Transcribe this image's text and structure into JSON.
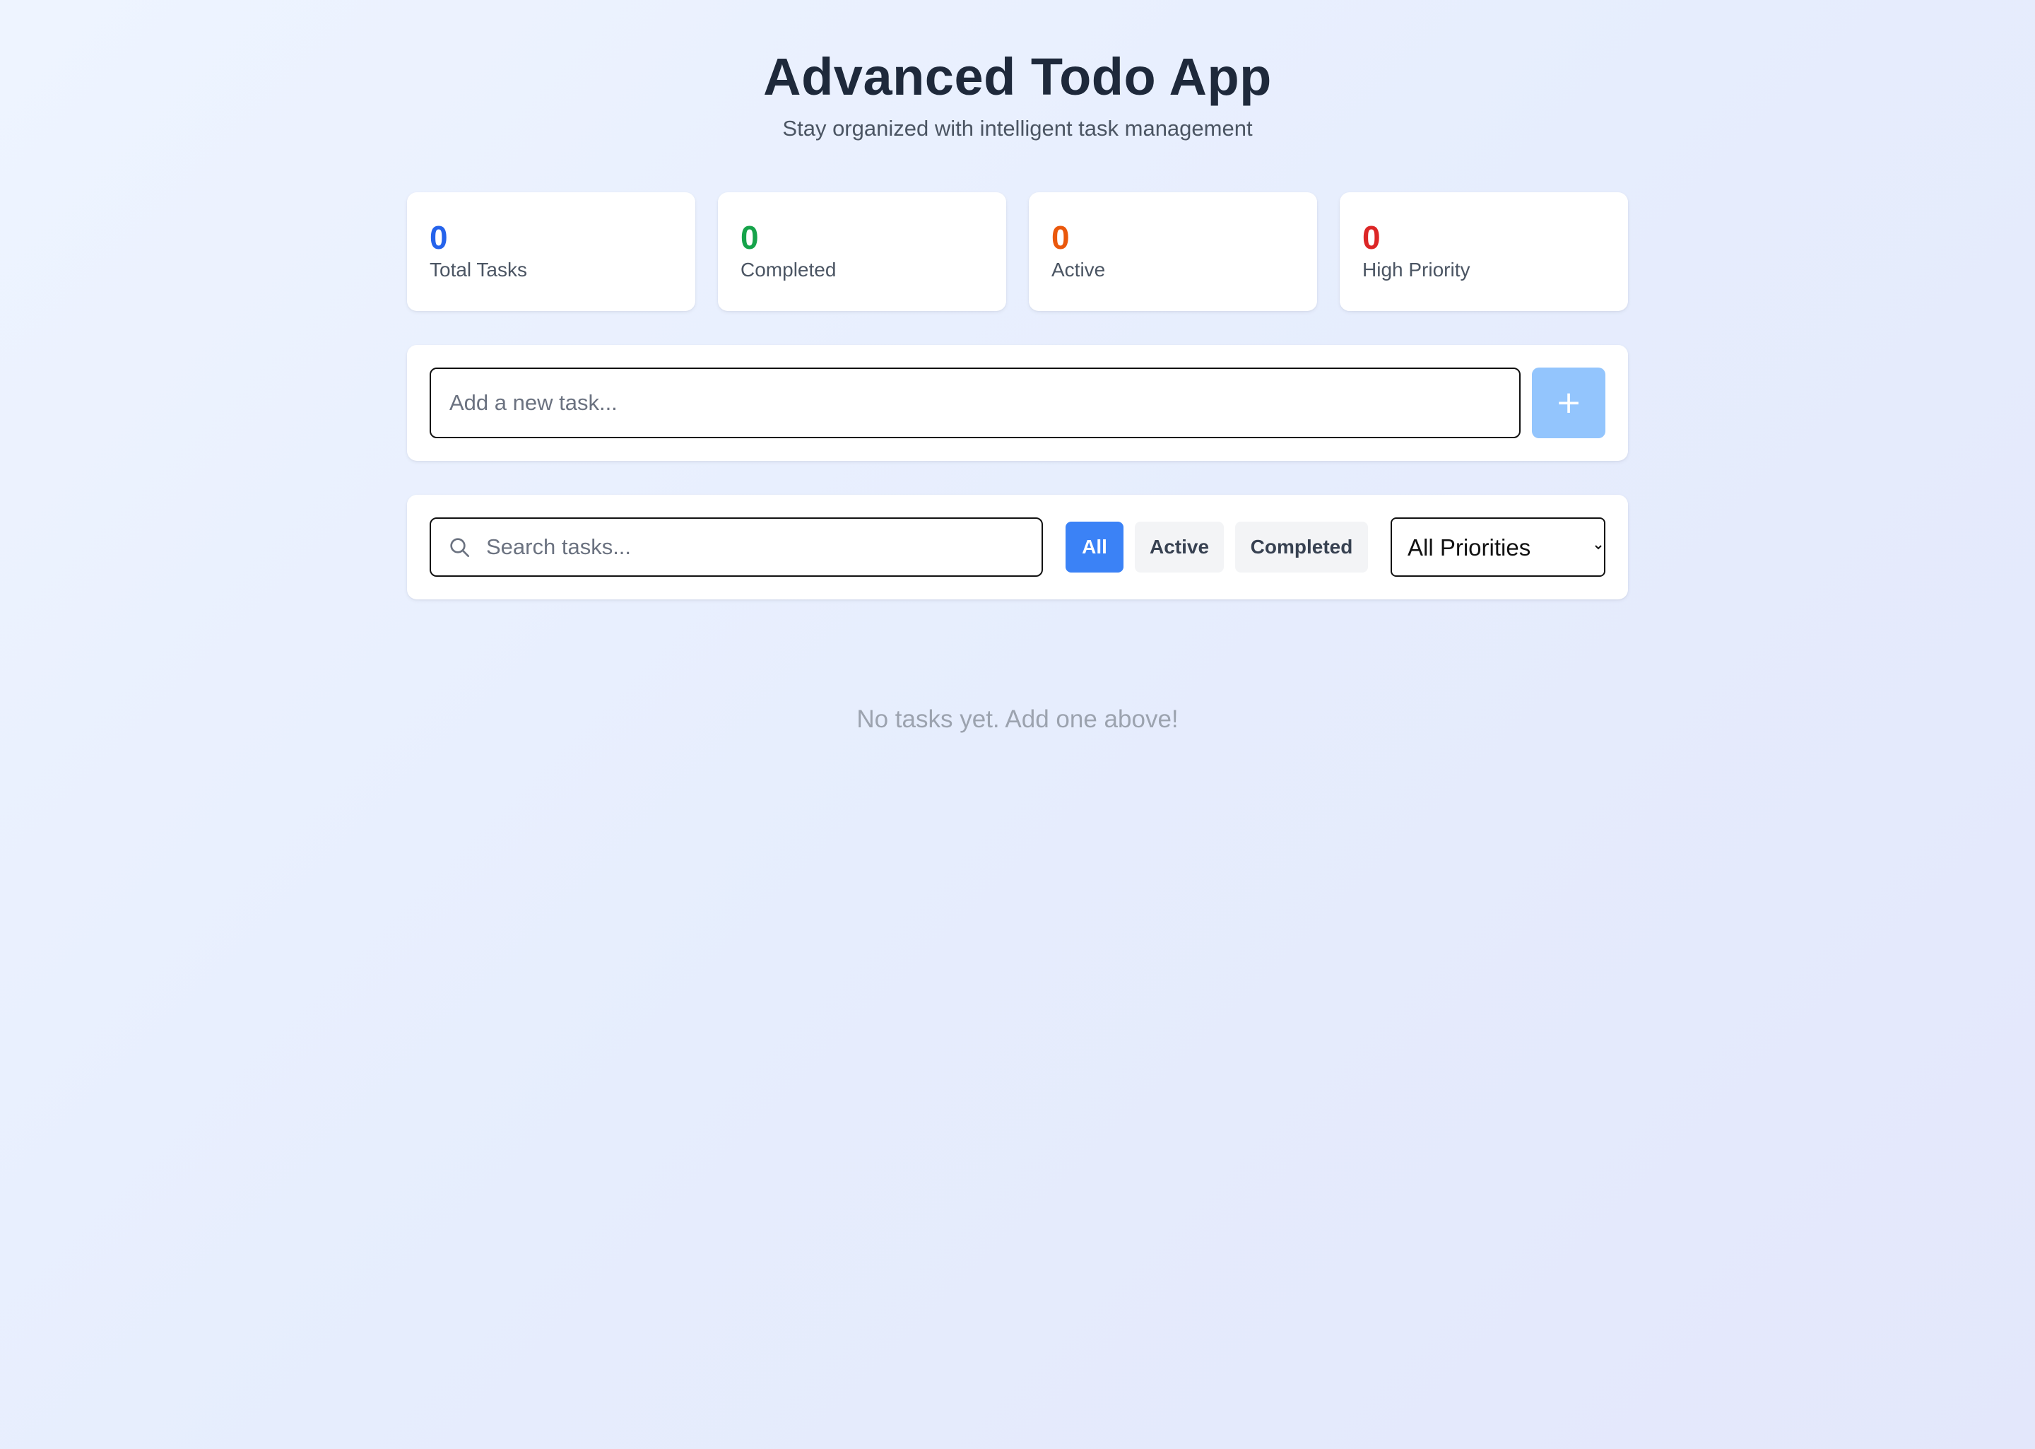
{
  "header": {
    "title": "Advanced Todo App",
    "subtitle": "Stay organized with intelligent task management"
  },
  "stats": [
    {
      "value": "0",
      "label": "Total Tasks",
      "color": "#2563eb"
    },
    {
      "value": "0",
      "label": "Completed",
      "color": "#16a34a"
    },
    {
      "value": "0",
      "label": "Active",
      "color": "#ea580c"
    },
    {
      "value": "0",
      "label": "High Priority",
      "color": "#dc2626"
    }
  ],
  "add_task": {
    "placeholder": "Add a new task...",
    "value": "",
    "button_icon": "plus-icon",
    "button_label": "+",
    "button_color": "#93c5fd"
  },
  "filters": {
    "search_placeholder": "Search tasks...",
    "search_value": "",
    "search_icon": "search-icon",
    "buttons": [
      {
        "label": "All",
        "selected": true
      },
      {
        "label": "Active",
        "selected": false
      },
      {
        "label": "Completed",
        "selected": false
      }
    ],
    "priority_selected": "All Priorities",
    "accent_color": "#3b82f6"
  },
  "empty_message": "No tasks yet. Add one above!"
}
